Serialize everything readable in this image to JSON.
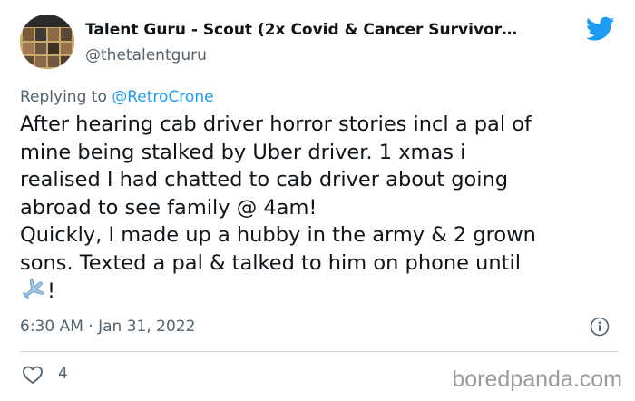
{
  "author": {
    "display_name": "Talent Guru - Scout (2x Covid & Cancer Survivor…",
    "handle": "@thetalentguru"
  },
  "reply": {
    "prefix": "Replying to",
    "to_handle": "@RetroCrone"
  },
  "tweet": {
    "lines": [
      "After hearing cab driver horror stories incl a pal of",
      "mine being stalked by Uber driver. 1 xmas i",
      "realised I had chatted to cab driver about going",
      "abroad to see family @ 4am!",
      "Quickly, I made up a hubby in the army & 2 grown",
      "sons. Texted a pal & talked to him on phone until"
    ],
    "last_line_suffix": "!",
    "emoji": "airplane"
  },
  "meta": {
    "timestamp": "6:30 AM · Jan 31, 2022"
  },
  "actions": {
    "like_count": "4"
  },
  "watermark": "boredpanda.com",
  "icons": {
    "logo": "twitter-bird-icon",
    "info": "info-icon",
    "like": "heart-icon",
    "emoji": "airplane-icon"
  },
  "colors": {
    "text_primary": "#0f1419",
    "text_secondary": "#536471",
    "link": "#1d9bf0",
    "twitter_blue": "#1d9bf0",
    "divider": "#cfd9de",
    "watermark": "#9a9a9a"
  }
}
